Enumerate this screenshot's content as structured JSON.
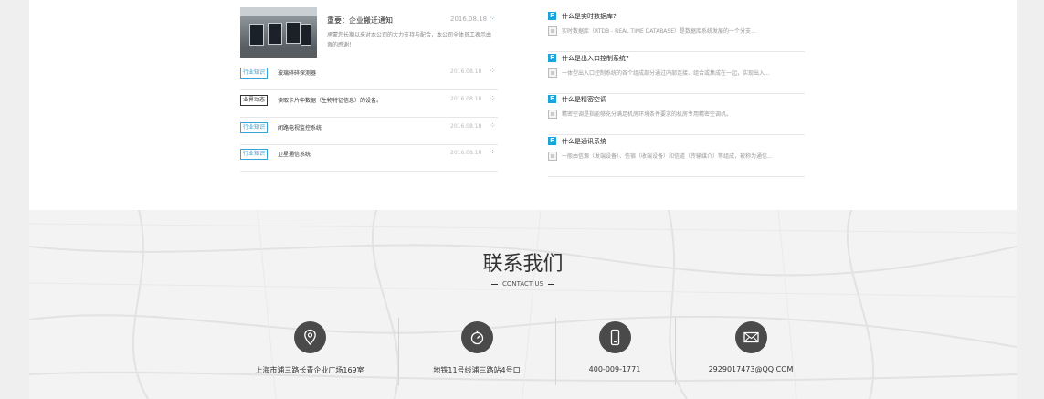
{
  "news": {
    "featured": {
      "title": "重要：企业搬迁通知",
      "date": "2016.08.18",
      "desc": "承蒙您长期以来对本公司的大力支持与配合，本公司全体员工表示由衷的感谢！"
    },
    "items": [
      {
        "tag": "行业知识",
        "tag_style": "blue",
        "title": "玻璃碎碎探测器",
        "date": "2016.08.18"
      },
      {
        "tag": "业界动态",
        "tag_style": "dark",
        "title": "读取卡片中数据（生物特征信息）的设备。",
        "date": "2016.08.18"
      },
      {
        "tag": "行业知识",
        "tag_style": "blue",
        "title": "闭路电视监控系统",
        "date": "2016.08.18"
      },
      {
        "tag": "行业知识",
        "tag_style": "blue",
        "title": "卫星通信系统",
        "date": "2016.08.18"
      }
    ]
  },
  "faq": {
    "q_badge": "F",
    "items": [
      {
        "q": "什么是实时数据库?",
        "a": "实时数据库（RTDB - REAL TIME DATABASE）是数据库系统发展的一个分支..."
      },
      {
        "q": "什么是出入口控制系统?",
        "a": "一体型出入口控制系统的各个组成部分通过内部连接、组合或集成在一起，实现出入..."
      },
      {
        "q": "什么是精密空调",
        "a": "精密空调是指能够充分满足机房环境条件要求的机房专用精密空调机。"
      },
      {
        "q": "什么是通讯系统",
        "a": "一般由信源（发端设备）、信宿（收端设备）和信道（传输媒介）等组成，被称为通信..."
      }
    ]
  },
  "contact": {
    "title": "联系我们",
    "subtitle": "CONTACT US",
    "items": [
      {
        "icon": "location-pin-icon",
        "text": "上海市浦三路长青企业广场169室"
      },
      {
        "icon": "stopwatch-icon",
        "text": "地铁11号线浦三路站4号口"
      },
      {
        "icon": "mobile-phone-icon",
        "text": "400-009-1771"
      },
      {
        "icon": "envelope-icon",
        "text": "2929017473@QQ.COM"
      }
    ]
  },
  "colors": {
    "accent": "#1aa4de",
    "icon_circle": "#4a4a4a"
  }
}
